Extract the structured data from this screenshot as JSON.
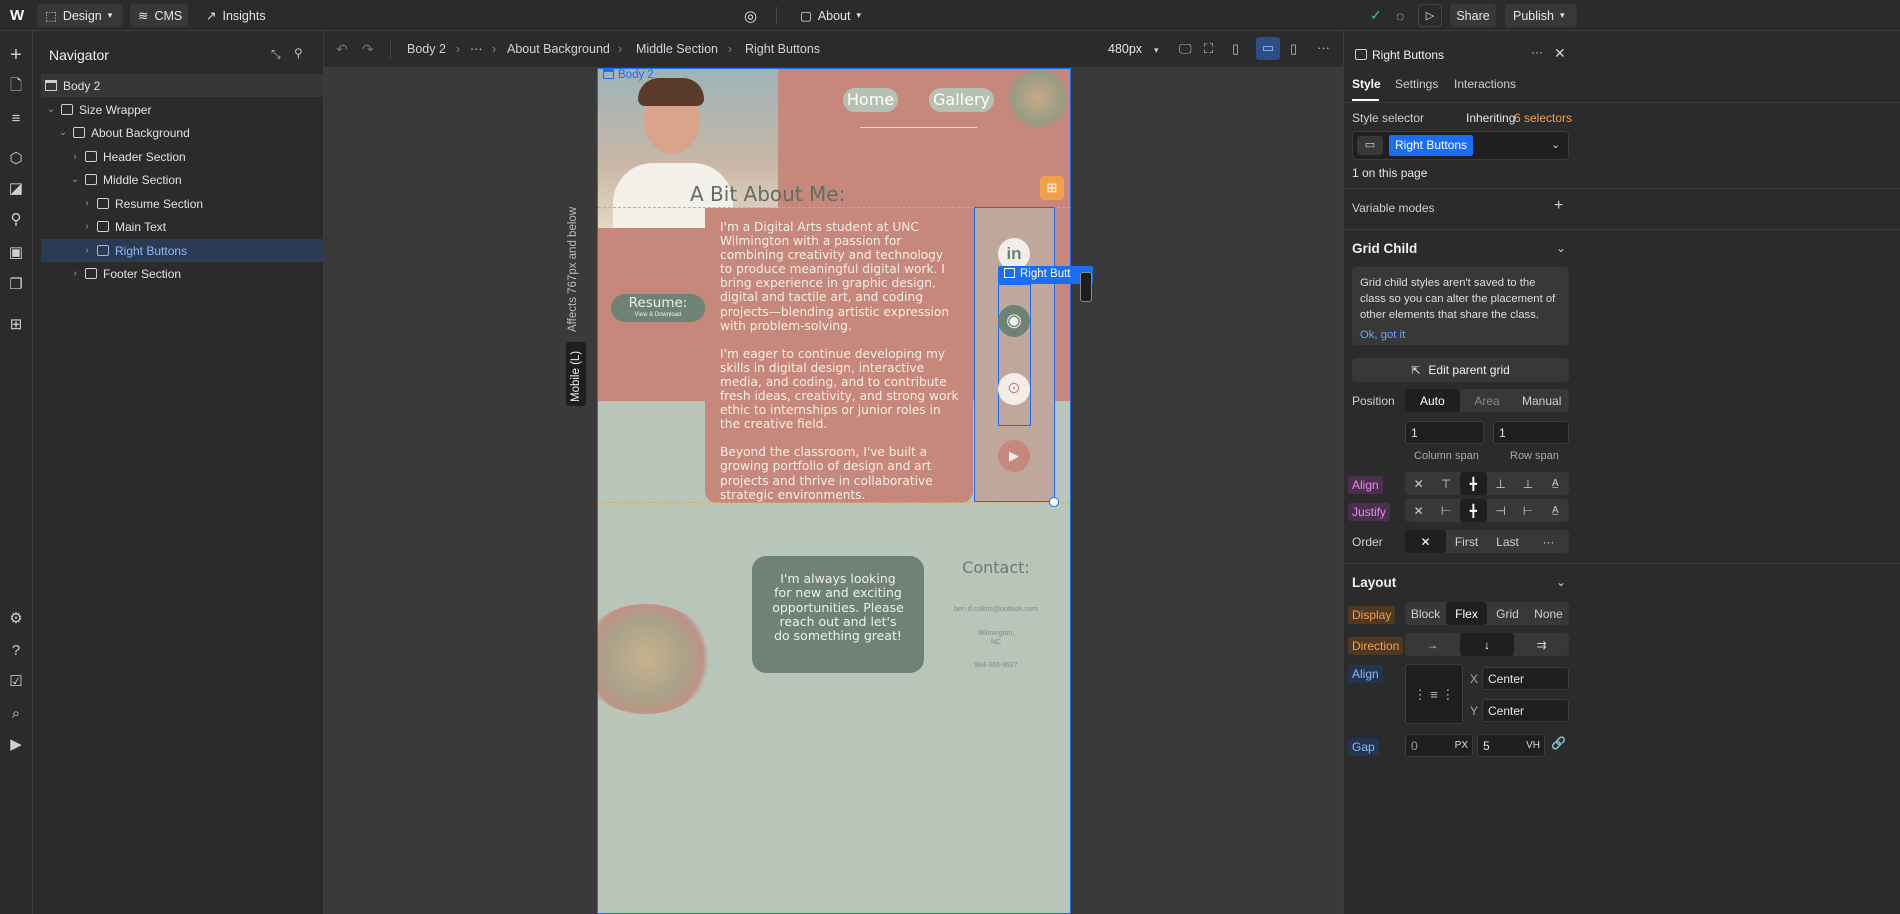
{
  "topbar": {
    "design_label": "Design",
    "cms_label": "CMS",
    "insights_label": "Insights",
    "page_label": "About",
    "share_label": "Share",
    "publish_label": "Publish"
  },
  "navigator": {
    "title": "Navigator",
    "items": [
      {
        "label": "Body 2"
      },
      {
        "label": "Size Wrapper"
      },
      {
        "label": "About Background"
      },
      {
        "label": "Header Section"
      },
      {
        "label": "Middle Section"
      },
      {
        "label": "Resume Section"
      },
      {
        "label": "Main Text"
      },
      {
        "label": "Right Buttons"
      },
      {
        "label": "Footer Section"
      }
    ]
  },
  "breadcrumb": {
    "items": [
      "Body 2",
      "About Background",
      "Middle Section",
      "Right Buttons"
    ],
    "ellipsis": "···",
    "width_label": "480px"
  },
  "canvas": {
    "body_tag": "Body 2",
    "selected_tag": "Right Butt",
    "breakpoint_note": "Affects 767px and below",
    "breakpoint_tag": "Mobile (L)"
  },
  "site": {
    "nav_home": "Home",
    "nav_gallery": "Gallery",
    "about_title": "A Bit About Me:",
    "resume_label": "Resume:",
    "resume_sub": "View & Download",
    "para1": "I'm a Digital Arts student at UNC Wilmington with a passion for combining creativity and technology to produce meaningful digital work. I bring experience in graphic design, digital and tactile art, and coding projects—blending artistic expression with problem-solving.",
    "para2": "I'm eager to continue developing my skills in digital design, interactive media, and coding, and to contribute fresh ideas, creativity, and strong work ethic to internships or junior roles in the creative field.",
    "para3": "Beyond the classroom, I've built a growing portfolio of design and art projects and thrive in collaborative strategic environments.",
    "contact_title": "Contact:",
    "contact_email": "ben.d.collins@outlook.com",
    "contact_city": "Wilmington,",
    "contact_state": "NC",
    "contact_phone": "984-365-9527",
    "reach_out": "I'm always looking for new and exciting opportunities. Please reach out and let's do something great!"
  },
  "panel": {
    "element_name": "Right Buttons",
    "tabs": [
      "Style",
      "Settings",
      "Interactions"
    ],
    "style_selector_label": "Style selector",
    "inheriting_label": "Inheriting",
    "inheriting_count": "6 selectors",
    "selector_chip": "Right Buttons",
    "on_page": "1 on this page",
    "variable_modes": "Variable modes",
    "grid_child_title": "Grid Child",
    "grid_child_note": "Grid child styles aren't saved to the class so you can alter the placement of other elements that share the class.",
    "ok_got_it": "Ok, got it",
    "edit_parent_grid": "Edit parent grid",
    "position_label": "Position",
    "position_options": [
      "Auto",
      "Area",
      "Manual"
    ],
    "column_span_value": "1",
    "row_span_value": "1",
    "column_span_label": "Column span",
    "row_span_label": "Row span",
    "align_label": "Align",
    "justify_label": "Justify",
    "order_label": "Order",
    "order_options": [
      "First",
      "Last"
    ],
    "layout_title": "Layout",
    "display_label": "Display",
    "display_options": [
      "Block",
      "Flex",
      "Grid",
      "None"
    ],
    "direction_label": "Direction",
    "align2_label": "Align",
    "align_x_label": "X",
    "align_x_value": "Center",
    "align_y_label": "Y",
    "align_y_value": "Center",
    "gap_label": "Gap",
    "gap_value1": "0",
    "gap_unit1": "PX",
    "gap_value2": "5",
    "gap_unit2": "VH"
  },
  "colors": {
    "accent_blue": "#1b6ef3",
    "site_salmon": "#c6877c",
    "site_sage": "#b8c6ba",
    "site_dark_green": "#6e8275",
    "orange_highlight": "#f2a14b",
    "pink_label": "#e58be6",
    "blue_label": "#8fbaf5"
  }
}
